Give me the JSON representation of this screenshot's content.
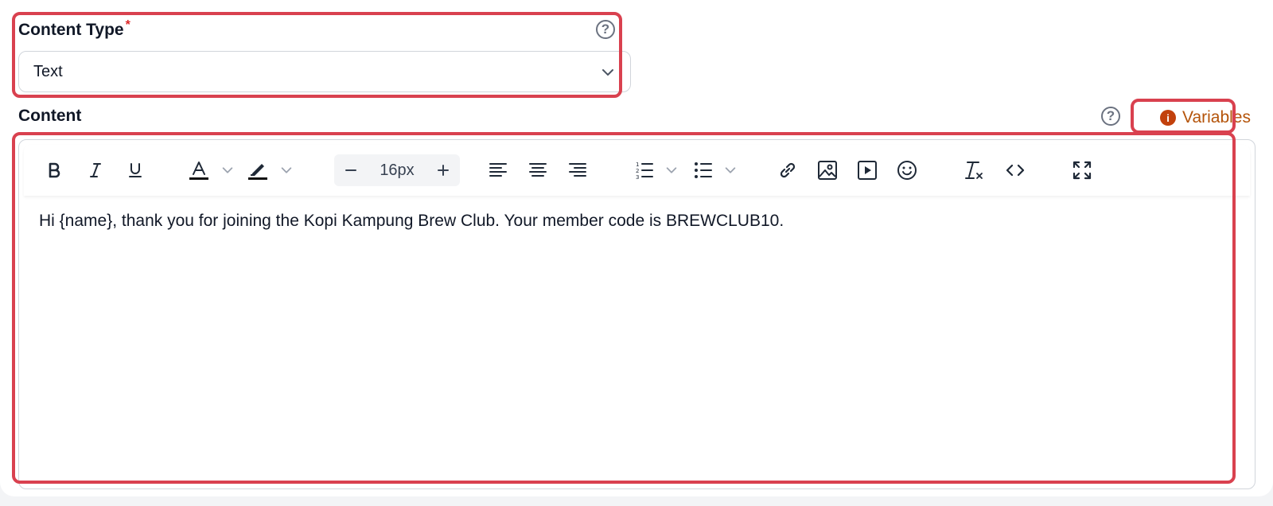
{
  "content_type": {
    "label": "Content Type",
    "required_mark": "*",
    "help": "?",
    "selected": "Text"
  },
  "content": {
    "label": "Content",
    "help": "?",
    "variables_label": "Variables",
    "variables_icon": "i",
    "text": "Hi {name}, thank you for joining the Kopi Kampung Brew Club. Your member code is BREWCLUB10."
  },
  "toolbar": {
    "font_size": "16px",
    "icons": [
      "bold-icon",
      "italic-icon",
      "underline-icon",
      "text-color-icon",
      "highlight-icon",
      "decrease-font-icon",
      "increase-font-icon",
      "align-left-icon",
      "align-center-icon",
      "align-right-icon",
      "ordered-list-icon",
      "bullet-list-icon",
      "link-icon",
      "image-icon",
      "video-icon",
      "emoji-icon",
      "clear-format-icon",
      "code-icon",
      "fullscreen-icon"
    ]
  },
  "colors": {
    "highlight": "#d9414f",
    "required": "#dc2626",
    "variables": "#b45309"
  }
}
